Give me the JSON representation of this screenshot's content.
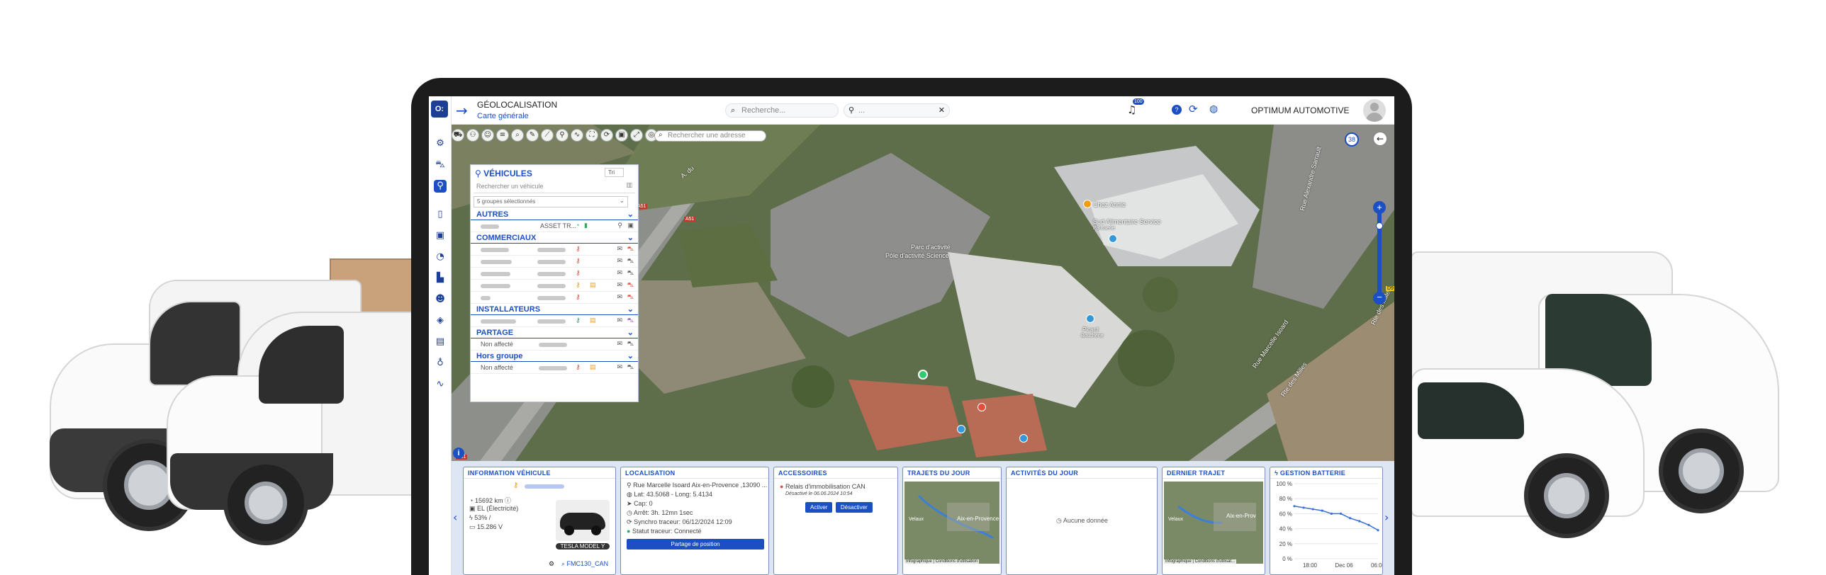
{
  "header": {
    "title": "GÉOLOCALISATION",
    "subtitle": "Carte générale",
    "search_placeholder": "Recherche...",
    "location_placeholder": "...",
    "notification_count": "100",
    "company": "OPTIMUM AUTOMOTIVE"
  },
  "map": {
    "address_placeholder": "Rechercher une adresse",
    "zoom_level": "38",
    "labels": {
      "chez_annie": "Chez Annie",
      "sud_alimentaire": "Sud Alimentaire Service",
      "sud_alimentaire_sub": "Pâtisserie",
      "parc_activite": "Parc d'activité",
      "parc_activite_2": "Pôle d'activité Science",
      "picard": "Picard",
      "picard_sub": "Boucherie",
      "rue_sarrault": "Rue Alexandre Sarrault",
      "rue_marcelle": "Rue Marcelle Isoard",
      "rte_milles": "Rte des Milles",
      "rte_milles_2": "Rte des Milles",
      "a51_1": "A51",
      "a51_2": "A51",
      "a51_3": "A51",
      "d9": "D9",
      "rue_aloe": "A. du"
    }
  },
  "vehicles_panel": {
    "title": "VÉHICULES",
    "sort_label": "Tri",
    "search_placeholder": "Rechercher un véhicule",
    "groups_selected": "5 groupes sélectionnés",
    "groups": [
      {
        "name": "AUTRES",
        "rows": [
          {
            "status": "ASSET TR..."
          }
        ]
      },
      {
        "name": "COMMERCIAUX",
        "rows": [
          {},
          {},
          {},
          {},
          {}
        ]
      },
      {
        "name": "INSTALLATEURS",
        "rows": [
          {}
        ]
      },
      {
        "name": "PARTAGE",
        "rows": [
          {
            "status": "Non affecté"
          }
        ]
      },
      {
        "name": "Hors groupe",
        "rows": [
          {
            "status": "Non affecté"
          }
        ]
      }
    ]
  },
  "cards": {
    "vehicle_info": {
      "title": "INFORMATION VÉHICULE",
      "mileage": "15692 km",
      "energy": "EL (Électricité)",
      "battery": "53% /",
      "voltage": "15.286 V",
      "model_badge": "TESLA MODEL Y",
      "tracker": "FMC130_CAN"
    },
    "location": {
      "title": "LOCALISATION",
      "address": "Rue Marcelle Isoard Aix-en-Provence ,13090 ...",
      "coords": "Lat: 43.5068 - Long: 5.4134",
      "heading": "Cap: 0",
      "stopped": "Arrêt: 3h. 12mn 1sec",
      "sync": "Synchro traceur: 06/12/2024 12:09",
      "tracker_status": "Statut traceur: Connecté",
      "share_button": "Partage de position"
    },
    "accessories": {
      "title": "ACCESSOIRES",
      "relay": "Relais d'immobilisation CAN",
      "relay_date": "Désactivé le 06.06.2024 10:54",
      "activate": "Activer",
      "deactivate": "Désactiver"
    },
    "trips": {
      "title": "TRAJETS DU JOUR",
      "city": "Aix-en-Provence",
      "city2": "Velaux",
      "attribution": "Infographique | Conditions d'utilisation"
    },
    "activities": {
      "title": "ACTIVITÉS DU JOUR",
      "empty": "Aucune donnée"
    },
    "last_trip": {
      "title": "DERNIER TRAJET",
      "city": "Aix-en-Prov",
      "city2": "Velaux",
      "attribution": "Infographique | Conditions d'utilisat..."
    },
    "battery": {
      "title": "GESTION BATTERIE"
    }
  },
  "chart_data": {
    "type": "line",
    "title": "GESTION BATTERIE",
    "yticks": [
      "100 %",
      "80 %",
      "60 %",
      "40 %",
      "20 %",
      "0 %"
    ],
    "xticks": [
      "18:00",
      "Dec 06",
      "06:00"
    ],
    "ylim": [
      0,
      100
    ],
    "series": [
      {
        "values": [
          70,
          68,
          66,
          64,
          60,
          60,
          54,
          50,
          45,
          38
        ]
      }
    ],
    "grid": true
  },
  "colors": {
    "accent": "#1c4fc4",
    "brand": "#1c3f95"
  }
}
